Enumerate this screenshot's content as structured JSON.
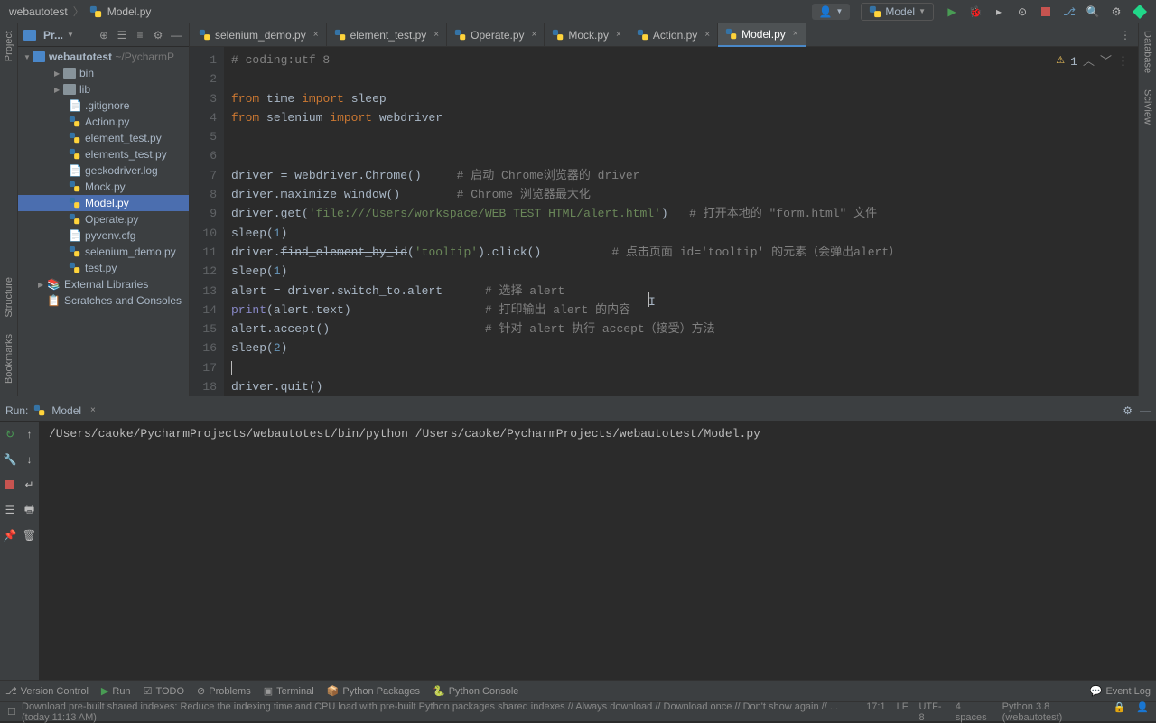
{
  "breadcrumb": {
    "project": "webautotest",
    "file": "Model.py"
  },
  "top_toolbar": {
    "run_config_label": "Model"
  },
  "left_tabs": {
    "project": "Project",
    "structure": "Structure",
    "bookmarks": "Bookmarks"
  },
  "right_tabs": {
    "database": "Database",
    "sciview": "SciView"
  },
  "project_panel": {
    "title": "Pr...",
    "root": {
      "name": "webautotest",
      "path": "~/PycharmP"
    },
    "children": [
      {
        "name": "bin",
        "type": "folder"
      },
      {
        "name": "lib",
        "type": "folder"
      },
      {
        "name": ".gitignore",
        "type": "file"
      },
      {
        "name": "Action.py",
        "type": "py"
      },
      {
        "name": "element_test.py",
        "type": "py"
      },
      {
        "name": "elements_test.py",
        "type": "py"
      },
      {
        "name": "geckodriver.log",
        "type": "file"
      },
      {
        "name": "Mock.py",
        "type": "py"
      },
      {
        "name": "Model.py",
        "type": "py",
        "selected": true
      },
      {
        "name": "Operate.py",
        "type": "py"
      },
      {
        "name": "pyvenv.cfg",
        "type": "file"
      },
      {
        "name": "selenium_demo.py",
        "type": "py"
      },
      {
        "name": "test.py",
        "type": "py"
      }
    ],
    "external": "External Libraries",
    "scratches": "Scratches and Consoles"
  },
  "tabs": [
    {
      "label": "selenium_demo.py"
    },
    {
      "label": "element_test.py"
    },
    {
      "label": "Operate.py"
    },
    {
      "label": "Mock.py"
    },
    {
      "label": "Action.py"
    },
    {
      "label": "Model.py",
      "active": true
    }
  ],
  "editor": {
    "warning_count": "1",
    "lines": [
      1,
      2,
      3,
      4,
      5,
      6,
      7,
      8,
      9,
      10,
      11,
      12,
      13,
      14,
      15,
      16,
      17,
      18
    ],
    "code": {
      "l1_cm": "# coding:utf-8",
      "l3_from": "from",
      "l3_mod": "time",
      "l3_imp": "import",
      "l3_name": "sleep",
      "l4_from": "from",
      "l4_mod": "selenium",
      "l4_imp": "import",
      "l4_name": "webdriver",
      "l7a": "driver = webdriver.Chrome()",
      "l7c": "# 启动 Chrome浏览器的 driver",
      "l8a": "driver.maximize_window()",
      "l8c": "# Chrome 浏览器最大化",
      "l9a": "driver.get(",
      "l9s": "'file:///Users/workspace/WEB_TEST_HTML/alert.html'",
      "l9b": ")",
      "l9c": "# 打开本地的 \"form.html\" 文件",
      "l10a": "sleep(",
      "l10n": "1",
      "l10b": ")",
      "l11a": "driver.",
      "l11strike": "find_element_by_id",
      "l11b": "(",
      "l11s": "'tooltip'",
      "l11c": ").click()",
      "l11cm": "# 点击页面 id='tooltip' 的元素（会弹出alert）",
      "l12a": "sleep(",
      "l12n": "1",
      "l12b": ")",
      "l13a": "alert = driver.switch_to.alert",
      "l13c": "# 选择 alert",
      "l14bi": "print",
      "l14a": "(alert.text)",
      "l14c": "# 打印输出 alert 的内容",
      "l15a": "alert.accept()",
      "l15c": "# 针对 alert 执行 accept（接受）方法",
      "l16a": "sleep(",
      "l16n": "2",
      "l16b": ")",
      "l18a": "driver.quit()"
    }
  },
  "run": {
    "label": "Run:",
    "config": "Model",
    "output": "/Users/caoke/PycharmProjects/webautotest/bin/python /Users/caoke/PycharmProjects/webautotest/Model.py"
  },
  "bottom_tools": {
    "vcs": "Version Control",
    "run": "Run",
    "todo": "TODO",
    "problems": "Problems",
    "terminal": "Terminal",
    "pypkg": "Python Packages",
    "pyconsole": "Python Console",
    "eventlog": "Event Log"
  },
  "status": {
    "msg": "Download pre-built shared indexes: Reduce the indexing time and CPU load with pre-built Python packages shared indexes // Always download // Download once // Don't show again // ... (today 11:13 AM)",
    "cursor": "17:1",
    "le": "LF",
    "enc": "UTF-8",
    "indent": "4 spaces",
    "interp": "Python 3.8 (webautotest)"
  }
}
